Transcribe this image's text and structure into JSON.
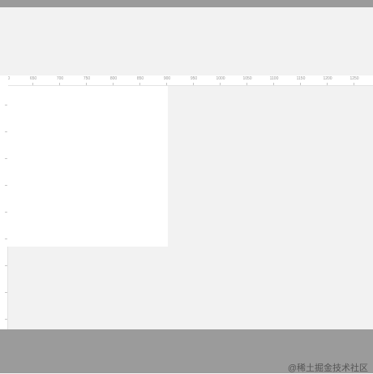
{
  "ruler": {
    "horizontal_labels": [
      "600",
      "650",
      "700",
      "750",
      "800",
      "850",
      "900",
      "950",
      "1000",
      "1050",
      "1100",
      "1150",
      "1200",
      "1250"
    ]
  },
  "watermark": "@稀土掘金技术社区",
  "colors": {
    "chrome": "#9b9b9b",
    "canvas": "#f2f2f2",
    "artboard": "#ffffff",
    "ruler_text": "#9a9a9a"
  }
}
